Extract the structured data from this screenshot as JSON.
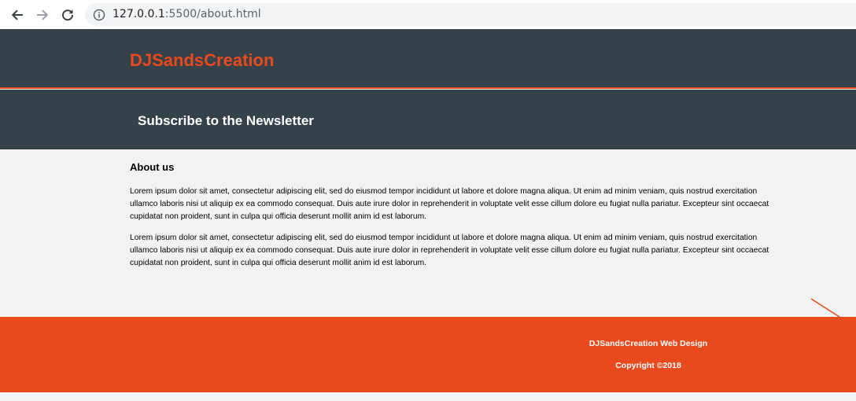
{
  "browser": {
    "url_host": "127.0.0.1",
    "url_path": ":5500/about.html"
  },
  "header": {
    "brand": "DJSandsCreation"
  },
  "newsletter": {
    "title": "Subscribe to the Newsletter"
  },
  "main": {
    "heading": "About us",
    "paragraphs": [
      "Lorem ipsum dolor sit amet, consectetur adipiscing elit, sed do eiusmod tempor incididunt ut labore et dolore magna aliqua. Ut enim ad minim veniam, quis nostrud exercitation ullamco laboris nisi ut aliquip ex ea commodo consequat. Duis aute irure dolor in reprehenderit in voluptate velit esse cillum dolore eu fugiat nulla pariatur. Excepteur sint occaecat cupidatat non proident, sunt in culpa qui officia deserunt mollit anim id est laborum.",
      "Lorem ipsum dolor sit amet, consectetur adipiscing elit, sed do eiusmod tempor incididunt ut labore et dolore magna aliqua. Ut enim ad minim veniam, quis nostrud exercitation ullamco laboris nisi ut aliquip ex ea commodo consequat. Duis aute irure dolor in reprehenderit in voluptate velit esse cillum dolore eu fugiat nulla pariatur. Excepteur sint occaecat cupidatat non proident, sunt in culpa qui officia deserunt mollit anim id est laborum."
    ]
  },
  "footer": {
    "line1": "DJSandsCreation Web Design",
    "line2": "Copyright ©2018"
  },
  "colors": {
    "accent": "#e8491d",
    "dark": "#35424a",
    "content_bg": "#f2f2f2"
  },
  "icons": [
    "back-arrow-icon",
    "forward-arrow-icon",
    "reload-icon",
    "info-icon"
  ]
}
